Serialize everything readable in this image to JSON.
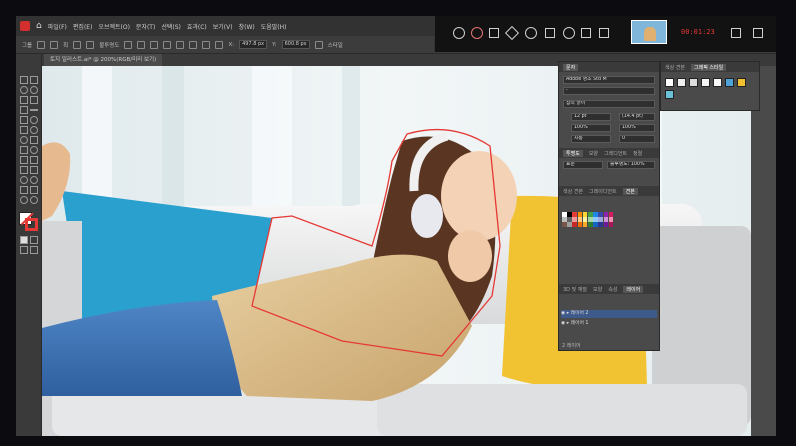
{
  "menu": [
    "파일(F)",
    "편집(E)",
    "오브젝트(O)",
    "문자(T)",
    "선택(S)",
    "효과(C)",
    "보기(V)",
    "창(W)",
    "도움말(H)"
  ],
  "options": {
    "group_label": "그룹",
    "stroke_label": "획",
    "opacity_label": "불투명도",
    "style_label": "스타일",
    "x_value": "497.8 px",
    "y_value": "600.8 px"
  },
  "document_tab": "토지 일러스트.ai* @ 200%(RGB/미리 보기)",
  "recorder": {
    "timer": "00:01:23"
  },
  "character_panel": {
    "tabs": [
      "문자"
    ],
    "font_family": "Adobe 명조 Std M",
    "font_style": "-",
    "variable_font": "참의 굵이",
    "font_size": "12 pt",
    "leading": "(14.4 pt)",
    "tracking": "100%",
    "kerning": "100%",
    "baseline": "자동",
    "tracking2": "0",
    "tabs2": [
      "투명도",
      "모양",
      "그레디언트",
      "정렬"
    ],
    "swatch_tabs": [
      "색상 견본",
      "그레이디언트",
      "견본"
    ],
    "blend_mode": "표준",
    "opacity": "불투명도: 100%"
  },
  "graphic_styles": {
    "tabs": [
      "색상 견본",
      "그래픽 스타일"
    ]
  },
  "layers": {
    "tabs": [
      "3D 및 재질",
      "모양",
      "속성",
      "레이어"
    ],
    "rows": [
      "레이어 2",
      "레이어 1"
    ],
    "count": "2 레이어"
  },
  "colors": {
    "accent": "#e53935",
    "ui_dark": "#3a3a3a",
    "ui_panel": "#4a4a4a"
  }
}
